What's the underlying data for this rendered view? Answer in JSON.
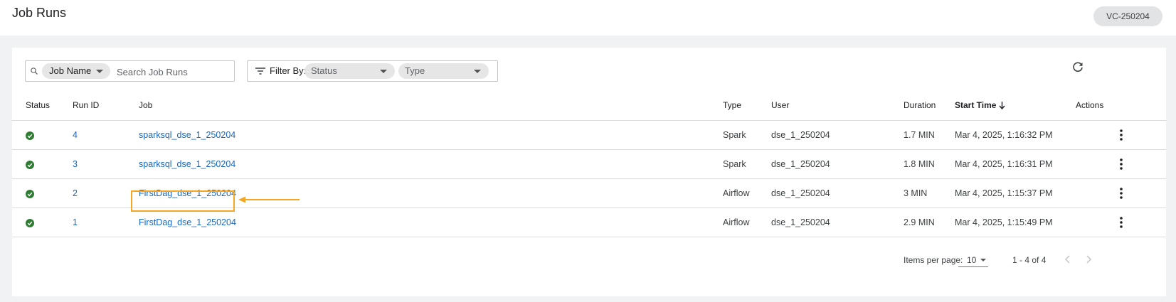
{
  "header": {
    "title": "Job Runs",
    "vc_badge": "VC-250204"
  },
  "toolbar": {
    "search_chip": "Job Name",
    "search_placeholder": "Search Job Runs",
    "filter_label": "Filter By:",
    "status_chip": "Status",
    "type_chip": "Type"
  },
  "table": {
    "columns": {
      "status": "Status",
      "run_id": "Run ID",
      "job": "Job",
      "type": "Type",
      "user": "User",
      "duration": "Duration",
      "start_time": "Start Time",
      "actions": "Actions"
    },
    "sorted_column": "start_time",
    "sort_direction": "descending",
    "rows": [
      {
        "status": "success",
        "run_id": "4",
        "job": "sparksql_dse_1_250204",
        "type": "Spark",
        "user": "dse_1_250204",
        "duration": "1.7 MIN",
        "start_time": "Mar 4, 2025, 1:16:32 PM"
      },
      {
        "status": "success",
        "run_id": "3",
        "job": "sparksql_dse_1_250204",
        "type": "Spark",
        "user": "dse_1_250204",
        "duration": "1.8 MIN",
        "start_time": "Mar 4, 2025, 1:16:31 PM"
      },
      {
        "status": "success",
        "run_id": "2",
        "job": "FirstDag_dse_1_250204",
        "type": "Airflow",
        "user": "dse_1_250204",
        "duration": "3 MIN",
        "start_time": "Mar 4, 2025, 1:15:37 PM",
        "highlighted": true
      },
      {
        "status": "success",
        "run_id": "1",
        "job": "FirstDag_dse_1_250204",
        "type": "Airflow",
        "user": "dse_1_250204",
        "duration": "2.9 MIN",
        "start_time": "Mar 4, 2025, 1:15:49 PM"
      }
    ]
  },
  "pagination": {
    "items_per_page_label": "Items per page:",
    "page_size": "10",
    "range": "1 - 4 of 4"
  },
  "colors": {
    "link": "#1867c0",
    "success": "#2e7d32",
    "highlight": "#f5a623"
  }
}
